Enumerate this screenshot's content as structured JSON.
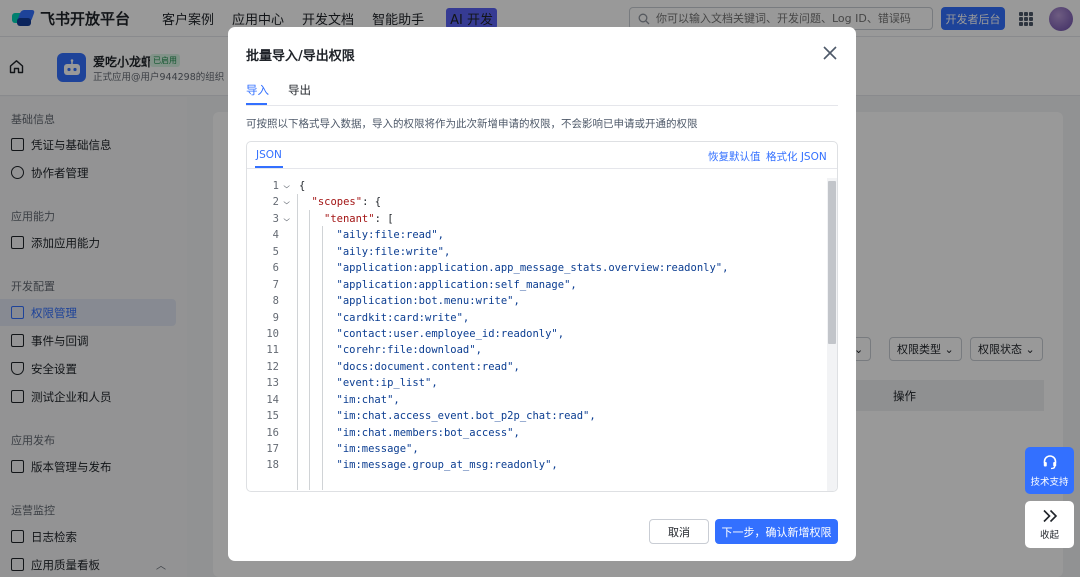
{
  "topbar": {
    "brand": "飞书开放平台",
    "nav": [
      "客户案例",
      "应用中心",
      "开发文档",
      "智能助手"
    ],
    "ai_badge": "AI 开发",
    "search_placeholder": "你可以输入文档关键词、开发问题、Log ID、错误码",
    "dev_console": "开发者后台"
  },
  "app": {
    "name": "爱吃小龙虾",
    "status": "已启用",
    "owner": "正式应用@用户944298的组织"
  },
  "sidebar": {
    "groups": [
      {
        "title": "基础信息",
        "items": [
          "凭证与基础信息",
          "协作者管理"
        ]
      },
      {
        "title": "应用能力",
        "items": [
          "添加应用能力"
        ]
      },
      {
        "title": "开发配置",
        "items": [
          "权限管理",
          "事件与回调",
          "安全设置",
          "测试企业和人员"
        ]
      },
      {
        "title": "应用发布",
        "items": [
          "版本管理与发布"
        ]
      },
      {
        "title": "运营监控",
        "items": [
          "日志检索",
          "应用质量看板"
        ]
      }
    ],
    "active_item": "权限管理"
  },
  "background": {
    "filters": [
      "权限类型",
      "权限状态"
    ],
    "column_op": "操作"
  },
  "floating": {
    "support": "技术支持",
    "collapse": "收起"
  },
  "modal": {
    "title": "批量导入/导出权限",
    "tabs": [
      "导入",
      "导出"
    ],
    "active_tab": "导入",
    "description": "可按照以下格式导入数据，导入的权限将作为此次新增申请的权限，不会影响已申请或开通的权限",
    "editor": {
      "format_tab": "JSON",
      "restore_default": "恢复默认值",
      "format_json": "格式化 JSON",
      "lines": [
        {
          "n": "1",
          "fold": true,
          "indent": 0,
          "key": "",
          "text": "{"
        },
        {
          "n": "2",
          "fold": true,
          "indent": 1,
          "key": "\"scopes\"",
          "text": ": {"
        },
        {
          "n": "3",
          "fold": true,
          "indent": 2,
          "key": "\"tenant\"",
          "text": ": ["
        },
        {
          "n": "4",
          "fold": false,
          "indent": 3,
          "key": "",
          "text": "\"aily:file:read\","
        },
        {
          "n": "5",
          "fold": false,
          "indent": 3,
          "key": "",
          "text": "\"aily:file:write\","
        },
        {
          "n": "6",
          "fold": false,
          "indent": 3,
          "key": "",
          "text": "\"application:application.app_message_stats.overview:readonly\","
        },
        {
          "n": "7",
          "fold": false,
          "indent": 3,
          "key": "",
          "text": "\"application:application:self_manage\","
        },
        {
          "n": "8",
          "fold": false,
          "indent": 3,
          "key": "",
          "text": "\"application:bot.menu:write\","
        },
        {
          "n": "9",
          "fold": false,
          "indent": 3,
          "key": "",
          "text": "\"cardkit:card:write\","
        },
        {
          "n": "10",
          "fold": false,
          "indent": 3,
          "key": "",
          "text": "\"contact:user.employee_id:readonly\","
        },
        {
          "n": "11",
          "fold": false,
          "indent": 3,
          "key": "",
          "text": "\"corehr:file:download\","
        },
        {
          "n": "12",
          "fold": false,
          "indent": 3,
          "key": "",
          "text": "\"docs:document.content:read\","
        },
        {
          "n": "13",
          "fold": false,
          "indent": 3,
          "key": "",
          "text": "\"event:ip_list\","
        },
        {
          "n": "14",
          "fold": false,
          "indent": 3,
          "key": "",
          "text": "\"im:chat\","
        },
        {
          "n": "15",
          "fold": false,
          "indent": 3,
          "key": "",
          "text": "\"im:chat.access_event.bot_p2p_chat:read\","
        },
        {
          "n": "16",
          "fold": false,
          "indent": 3,
          "key": "",
          "text": "\"im:chat.members:bot_access\","
        },
        {
          "n": "17",
          "fold": false,
          "indent": 3,
          "key": "",
          "text": "\"im:message\","
        },
        {
          "n": "18",
          "fold": false,
          "indent": 3,
          "key": "",
          "text": "\"im:message.group_at_msg:readonly\","
        }
      ]
    },
    "cancel": "取消",
    "next": "下一步，确认新增权限"
  },
  "colors": {
    "accent": "#3370ff",
    "json_key": "#a31515",
    "json_string": "#0b3d91"
  }
}
